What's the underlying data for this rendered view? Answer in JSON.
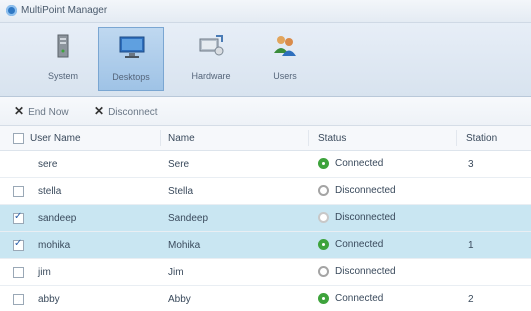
{
  "window": {
    "title": "MultiPoint Manager"
  },
  "ribbon": {
    "items": [
      {
        "label": "System",
        "icon": "system-icon",
        "active": false
      },
      {
        "label": "Desktops",
        "icon": "desktops-icon",
        "active": true
      },
      {
        "label": "Hardware",
        "icon": "hardware-icon",
        "active": false
      },
      {
        "label": "Users",
        "icon": "users-icon",
        "active": false
      }
    ]
  },
  "toolbar": {
    "end_now": "End Now",
    "disconnect": "Disconnect"
  },
  "table": {
    "columns": [
      "User Name",
      "Name",
      "Status",
      "Station"
    ],
    "rows": [
      {
        "user": "sere",
        "name": "Sere",
        "status": "Connected",
        "station": "3",
        "checkbox": false,
        "selected": false
      },
      {
        "user": "stella",
        "name": "Stella",
        "status": "Disconnected",
        "station": "",
        "checkbox": true,
        "selected": false
      },
      {
        "user": "sandeep",
        "name": "Sandeep",
        "status": "Disconnected",
        "station": "",
        "checkbox": true,
        "checked": true,
        "selected": true
      },
      {
        "user": "mohika",
        "name": "Mohika",
        "status": "Connected",
        "station": "1",
        "checkbox": true,
        "checked": true,
        "selected": true
      },
      {
        "user": "jim",
        "name": "Jim",
        "status": "Disconnected",
        "station": "",
        "checkbox": true,
        "selected": false
      },
      {
        "user": "abby",
        "name": "Abby",
        "status": "Connected",
        "station": "2",
        "checkbox": true,
        "selected": false
      }
    ]
  },
  "colors": {
    "connected": "#3ea33c",
    "disconnected": "#a4a4a4",
    "selected_row": "#c9e6f2"
  }
}
